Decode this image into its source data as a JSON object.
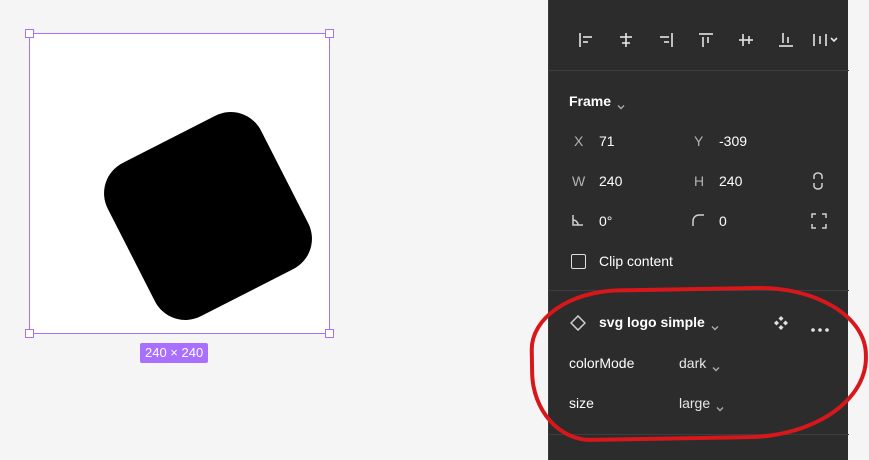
{
  "canvas": {
    "frame_size_label": "240 × 240",
    "selection_color": "#a970ff"
  },
  "panel": {
    "frame_section": {
      "title": "Frame",
      "x_label": "X",
      "x_value": "71",
      "y_label": "Y",
      "y_value": "-309",
      "w_label": "W",
      "w_value": "240",
      "h_label": "H",
      "h_value": "240",
      "rotation_value": "0°",
      "radius_value": "0",
      "clip_content_label": "Clip content",
      "clip_content_checked": false
    },
    "component_section": {
      "name": "svg logo simple",
      "props": [
        {
          "label": "colorMode",
          "value": "dark"
        },
        {
          "label": "size",
          "value": "large"
        }
      ]
    },
    "align_buttons": [
      "align-left-icon",
      "align-horizontal-center-icon",
      "align-right-icon",
      "align-top-icon",
      "align-vertical-center-icon",
      "align-bottom-icon",
      "distribute-icon"
    ]
  },
  "annotation_color": "#d8171b"
}
